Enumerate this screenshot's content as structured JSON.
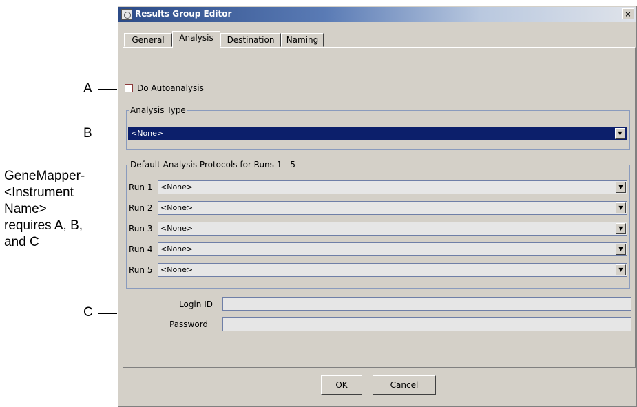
{
  "window": {
    "title": "Results Group Editor",
    "close_glyph": "×"
  },
  "tabs": [
    {
      "label": "General"
    },
    {
      "label": "Analysis"
    },
    {
      "label": "Destination"
    },
    {
      "label": "Naming"
    }
  ],
  "analysis": {
    "do_autoanalysis_label": "Do Autoanalysis",
    "do_autoanalysis_checked": false,
    "analysis_type_group": "Analysis Type",
    "analysis_type_value": "<None>",
    "protocols_group": "Default Analysis Protocols for Runs 1 - 5",
    "runs": [
      {
        "label": "Run 1",
        "value": "<None>"
      },
      {
        "label": "Run 2",
        "value": "<None>"
      },
      {
        "label": "Run 3",
        "value": "<None>"
      },
      {
        "label": "Run 4",
        "value": "<None>"
      },
      {
        "label": "Run 5",
        "value": "<None>"
      }
    ],
    "login_id_label": "Login ID",
    "login_id_value": "",
    "password_label": "Password",
    "password_value": ""
  },
  "buttons": {
    "ok": "OK",
    "cancel": "Cancel"
  },
  "callouts": {
    "a": "A",
    "b": "B",
    "c": "C",
    "note": "GeneMapper-\n<Instrument\nName>\nrequires A, B,\nand C"
  },
  "icons": {
    "app": "results-group-app-icon",
    "dropdown": "chevron-down-icon"
  }
}
